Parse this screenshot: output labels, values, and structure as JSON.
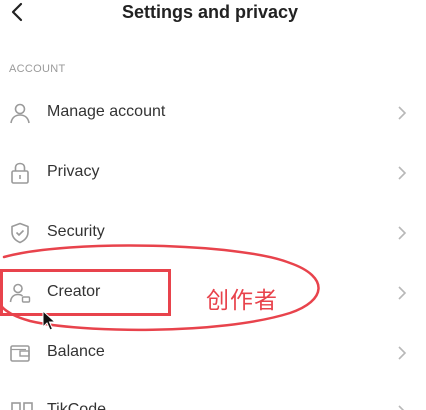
{
  "header": {
    "title": "Settings and privacy",
    "back_icon": "chevron-left-icon"
  },
  "section": {
    "label": "ACCOUNT"
  },
  "menu": {
    "items": [
      {
        "label": "Manage account",
        "icon": "person-icon"
      },
      {
        "label": "Privacy",
        "icon": "lock-icon"
      },
      {
        "label": "Security",
        "icon": "shield-icon"
      },
      {
        "label": "Creator",
        "icon": "creator-icon"
      },
      {
        "label": "Balance",
        "icon": "wallet-icon"
      },
      {
        "label": "TikCode",
        "icon": "qr-code-icon"
      }
    ]
  },
  "annotation": {
    "text": "创作者",
    "color": "#e8434c"
  },
  "colors": {
    "text_primary": "#333333",
    "text_secondary": "#9a9a9a",
    "icon": "#9a9a9a",
    "chevron": "#b8b8b8"
  }
}
